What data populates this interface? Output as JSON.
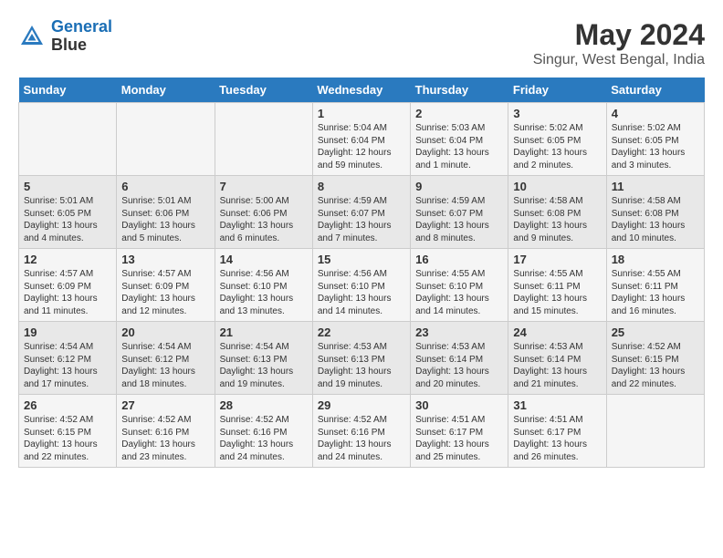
{
  "header": {
    "logo_line1": "General",
    "logo_line2": "Blue",
    "main_title": "May 2024",
    "sub_title": "Singur, West Bengal, India"
  },
  "weekdays": [
    "Sunday",
    "Monday",
    "Tuesday",
    "Wednesday",
    "Thursday",
    "Friday",
    "Saturday"
  ],
  "weeks": [
    [
      {
        "day": "",
        "info": ""
      },
      {
        "day": "",
        "info": ""
      },
      {
        "day": "",
        "info": ""
      },
      {
        "day": "1",
        "info": "Sunrise: 5:04 AM\nSunset: 6:04 PM\nDaylight: 12 hours\nand 59 minutes."
      },
      {
        "day": "2",
        "info": "Sunrise: 5:03 AM\nSunset: 6:04 PM\nDaylight: 13 hours\nand 1 minute."
      },
      {
        "day": "3",
        "info": "Sunrise: 5:02 AM\nSunset: 6:05 PM\nDaylight: 13 hours\nand 2 minutes."
      },
      {
        "day": "4",
        "info": "Sunrise: 5:02 AM\nSunset: 6:05 PM\nDaylight: 13 hours\nand 3 minutes."
      }
    ],
    [
      {
        "day": "5",
        "info": "Sunrise: 5:01 AM\nSunset: 6:05 PM\nDaylight: 13 hours\nand 4 minutes."
      },
      {
        "day": "6",
        "info": "Sunrise: 5:01 AM\nSunset: 6:06 PM\nDaylight: 13 hours\nand 5 minutes."
      },
      {
        "day": "7",
        "info": "Sunrise: 5:00 AM\nSunset: 6:06 PM\nDaylight: 13 hours\nand 6 minutes."
      },
      {
        "day": "8",
        "info": "Sunrise: 4:59 AM\nSunset: 6:07 PM\nDaylight: 13 hours\nand 7 minutes."
      },
      {
        "day": "9",
        "info": "Sunrise: 4:59 AM\nSunset: 6:07 PM\nDaylight: 13 hours\nand 8 minutes."
      },
      {
        "day": "10",
        "info": "Sunrise: 4:58 AM\nSunset: 6:08 PM\nDaylight: 13 hours\nand 9 minutes."
      },
      {
        "day": "11",
        "info": "Sunrise: 4:58 AM\nSunset: 6:08 PM\nDaylight: 13 hours\nand 10 minutes."
      }
    ],
    [
      {
        "day": "12",
        "info": "Sunrise: 4:57 AM\nSunset: 6:09 PM\nDaylight: 13 hours\nand 11 minutes."
      },
      {
        "day": "13",
        "info": "Sunrise: 4:57 AM\nSunset: 6:09 PM\nDaylight: 13 hours\nand 12 minutes."
      },
      {
        "day": "14",
        "info": "Sunrise: 4:56 AM\nSunset: 6:10 PM\nDaylight: 13 hours\nand 13 minutes."
      },
      {
        "day": "15",
        "info": "Sunrise: 4:56 AM\nSunset: 6:10 PM\nDaylight: 13 hours\nand 14 minutes."
      },
      {
        "day": "16",
        "info": "Sunrise: 4:55 AM\nSunset: 6:10 PM\nDaylight: 13 hours\nand 14 minutes."
      },
      {
        "day": "17",
        "info": "Sunrise: 4:55 AM\nSunset: 6:11 PM\nDaylight: 13 hours\nand 15 minutes."
      },
      {
        "day": "18",
        "info": "Sunrise: 4:55 AM\nSunset: 6:11 PM\nDaylight: 13 hours\nand 16 minutes."
      }
    ],
    [
      {
        "day": "19",
        "info": "Sunrise: 4:54 AM\nSunset: 6:12 PM\nDaylight: 13 hours\nand 17 minutes."
      },
      {
        "day": "20",
        "info": "Sunrise: 4:54 AM\nSunset: 6:12 PM\nDaylight: 13 hours\nand 18 minutes."
      },
      {
        "day": "21",
        "info": "Sunrise: 4:54 AM\nSunset: 6:13 PM\nDaylight: 13 hours\nand 19 minutes."
      },
      {
        "day": "22",
        "info": "Sunrise: 4:53 AM\nSunset: 6:13 PM\nDaylight: 13 hours\nand 19 minutes."
      },
      {
        "day": "23",
        "info": "Sunrise: 4:53 AM\nSunset: 6:14 PM\nDaylight: 13 hours\nand 20 minutes."
      },
      {
        "day": "24",
        "info": "Sunrise: 4:53 AM\nSunset: 6:14 PM\nDaylight: 13 hours\nand 21 minutes."
      },
      {
        "day": "25",
        "info": "Sunrise: 4:52 AM\nSunset: 6:15 PM\nDaylight: 13 hours\nand 22 minutes."
      }
    ],
    [
      {
        "day": "26",
        "info": "Sunrise: 4:52 AM\nSunset: 6:15 PM\nDaylight: 13 hours\nand 22 minutes."
      },
      {
        "day": "27",
        "info": "Sunrise: 4:52 AM\nSunset: 6:16 PM\nDaylight: 13 hours\nand 23 minutes."
      },
      {
        "day": "28",
        "info": "Sunrise: 4:52 AM\nSunset: 6:16 PM\nDaylight: 13 hours\nand 24 minutes."
      },
      {
        "day": "29",
        "info": "Sunrise: 4:52 AM\nSunset: 6:16 PM\nDaylight: 13 hours\nand 24 minutes."
      },
      {
        "day": "30",
        "info": "Sunrise: 4:51 AM\nSunset: 6:17 PM\nDaylight: 13 hours\nand 25 minutes."
      },
      {
        "day": "31",
        "info": "Sunrise: 4:51 AM\nSunset: 6:17 PM\nDaylight: 13 hours\nand 26 minutes."
      },
      {
        "day": "",
        "info": ""
      }
    ]
  ]
}
